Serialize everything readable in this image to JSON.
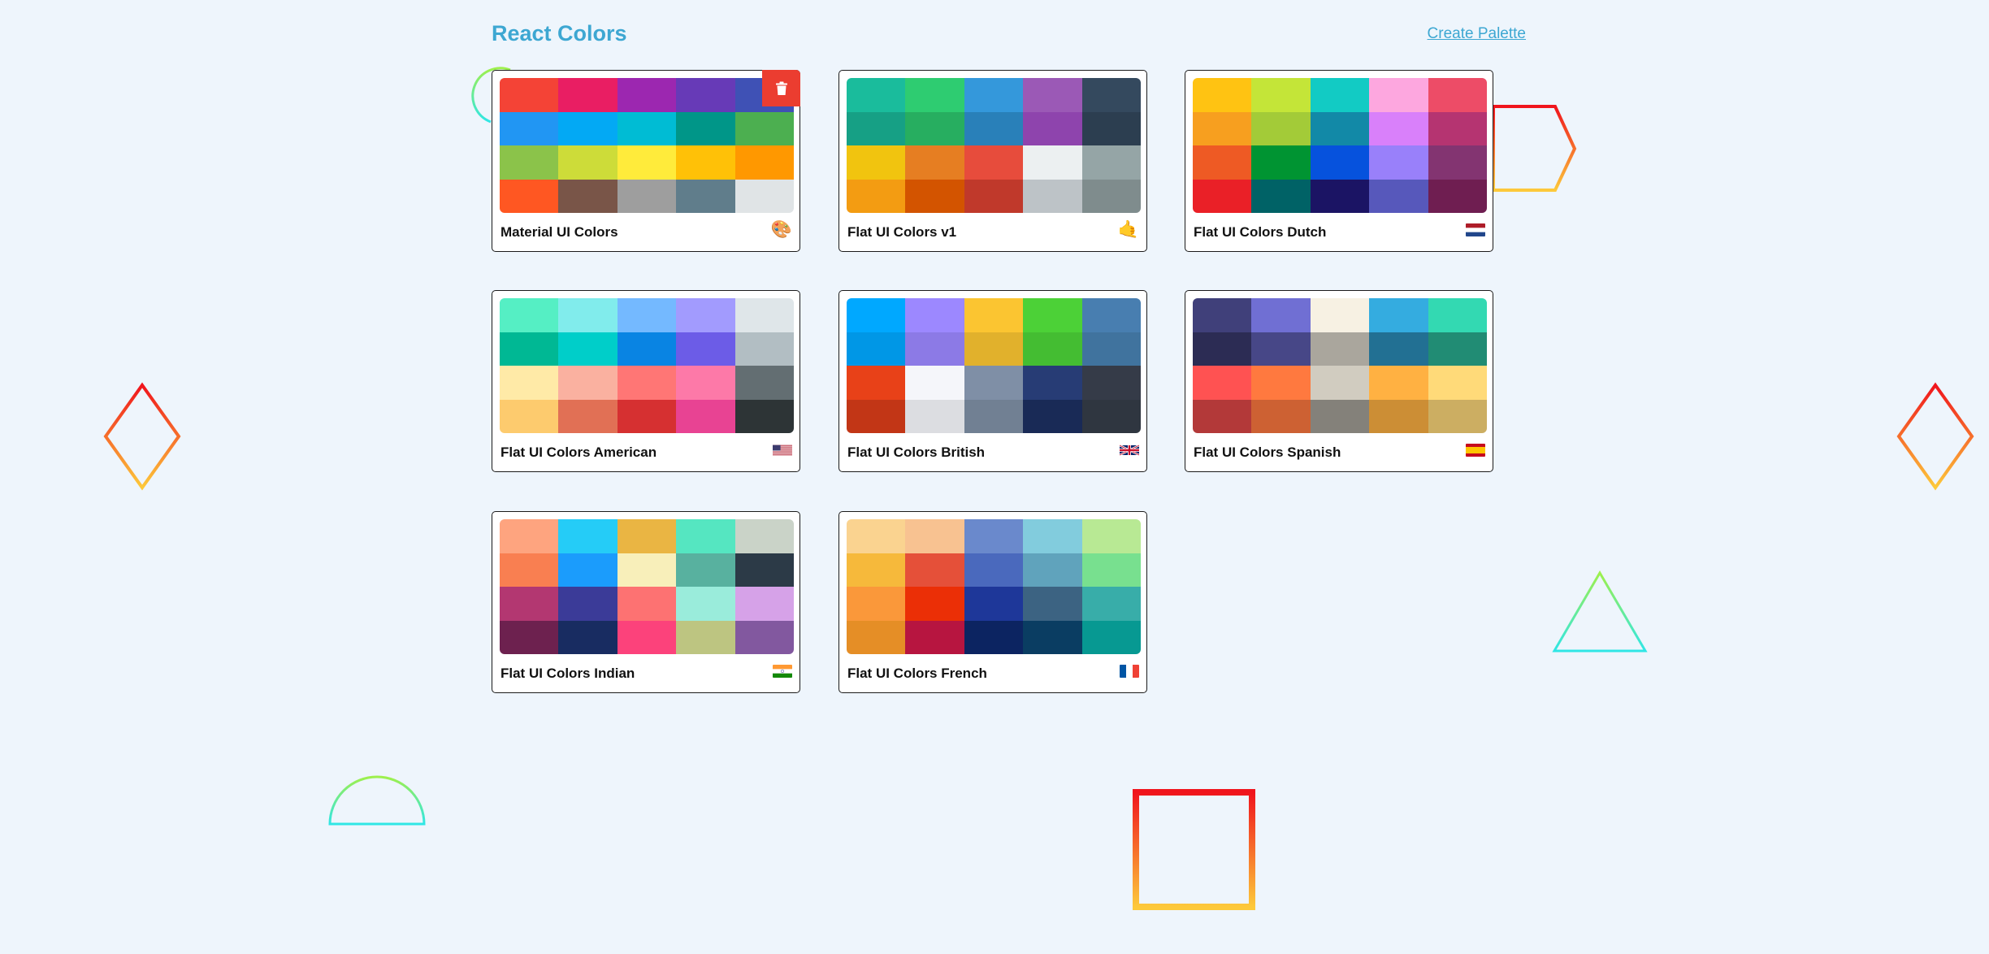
{
  "nav": {
    "title": "React Colors",
    "create_label": "Create Palette"
  },
  "palettes": [
    {
      "name": "Material UI Colors",
      "emoji": "🎨",
      "colors": [
        "#f44336",
        "#e91e63",
        "#9c27b0",
        "#673ab7",
        "#3f51b5",
        "#2196f3",
        "#03a9f4",
        "#00bcd4",
        "#009688",
        "#4caf50",
        "#8bc34a",
        "#cddc39",
        "#ffeb3b",
        "#ffc107",
        "#ff9800",
        "#ff5722",
        "#795548",
        "#9e9e9e",
        "#607d8b",
        "#e0e4e6"
      ]
    },
    {
      "name": "Flat UI Colors v1",
      "emoji": "🤙",
      "colors": [
        "#1abc9c",
        "#2ecc71",
        "#3498db",
        "#9b59b6",
        "#34495e",
        "#16a085",
        "#27ae60",
        "#2980b9",
        "#8e44ad",
        "#2c3e50",
        "#f1c40f",
        "#e67e22",
        "#e74c3c",
        "#ecf0f1",
        "#95a5a6",
        "#f39c12",
        "#d35400",
        "#c0392b",
        "#bdc3c7",
        "#7f8c8d"
      ]
    },
    {
      "name": "Flat UI Colors Dutch",
      "emoji": "flag-nl",
      "colors": [
        "#ffc312",
        "#c4e538",
        "#12cbc4",
        "#fda7df",
        "#ed4c67",
        "#f79f1f",
        "#a3cb38",
        "#1289a7",
        "#d980fa",
        "#b53471",
        "#ee5a24",
        "#009432",
        "#0652dd",
        "#9980fa",
        "#833471",
        "#ea2027",
        "#006266",
        "#1b1464",
        "#5758bb",
        "#6f1e51"
      ]
    },
    {
      "name": "Flat UI Colors American",
      "emoji": "flag-us",
      "colors": [
        "#55efc4",
        "#81ecec",
        "#74b9ff",
        "#a29bfe",
        "#dfe6e9",
        "#00b894",
        "#00cec9",
        "#0984e3",
        "#6c5ce7",
        "#b2bec3",
        "#ffeaa7",
        "#fab1a0",
        "#ff7675",
        "#fd79a8",
        "#636e72",
        "#fdcb6e",
        "#e17055",
        "#d63031",
        "#e84393",
        "#2d3436"
      ]
    },
    {
      "name": "Flat UI Colors British",
      "emoji": "flag-gb",
      "colors": [
        "#00a8ff",
        "#9c88ff",
        "#fbc531",
        "#4cd137",
        "#487eb0",
        "#0097e6",
        "#8c7ae6",
        "#e1b12c",
        "#44bd32",
        "#40739e",
        "#e84118",
        "#f5f6fa",
        "#7f8fa6",
        "#273c75",
        "#353b48",
        "#c23616",
        "#dcdde1",
        "#718093",
        "#192a56",
        "#2f3640"
      ]
    },
    {
      "name": "Flat UI Colors Spanish",
      "emoji": "flag-es",
      "colors": [
        "#40407a",
        "#706fd3",
        "#f7f1e3",
        "#34ace0",
        "#33d9b2",
        "#2c2c54",
        "#474787",
        "#aaa69d",
        "#227093",
        "#218c74",
        "#ff5252",
        "#ff793f",
        "#d1ccc0",
        "#ffb142",
        "#ffda79",
        "#b33939",
        "#cd6133",
        "#84817a",
        "#cc8e35",
        "#ccae62"
      ]
    },
    {
      "name": "Flat UI Colors Indian",
      "emoji": "flag-in",
      "colors": [
        "#fea47f",
        "#25ccf7",
        "#eab543",
        "#55e6c1",
        "#cad3c8",
        "#f97f51",
        "#1b9cfc",
        "#f8efba",
        "#58b19f",
        "#2c3a47",
        "#b33771",
        "#3b3b98",
        "#fd7272",
        "#9aecdb",
        "#d6a2e8",
        "#6d214f",
        "#182c61",
        "#fc427b",
        "#bdc581",
        "#82589f"
      ]
    },
    {
      "name": "Flat UI Colors French",
      "emoji": "flag-fr",
      "colors": [
        "#fad390",
        "#f8c291",
        "#6a89cc",
        "#82ccdd",
        "#b8e994",
        "#f6b93b",
        "#e55039",
        "#4a69bd",
        "#60a3bc",
        "#78e08f",
        "#fa983a",
        "#eb2f06",
        "#1e3799",
        "#3c6382",
        "#38ada9",
        "#e58e26",
        "#b71540",
        "#0c2461",
        "#0a3d62",
        "#079992"
      ]
    }
  ]
}
